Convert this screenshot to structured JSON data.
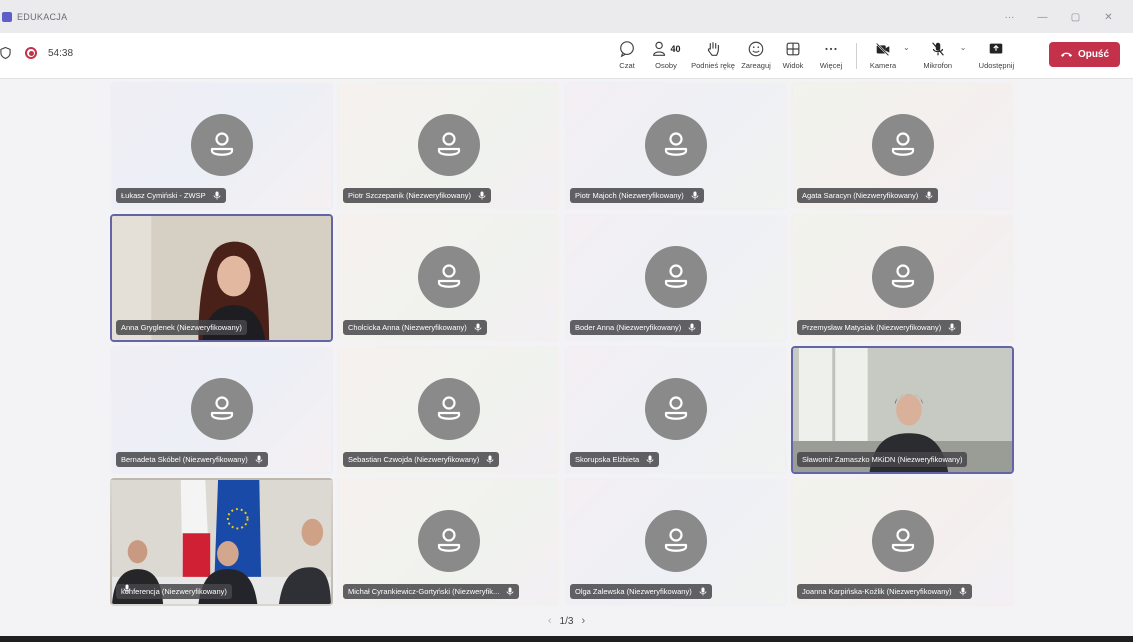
{
  "window": {
    "title": "EDUKACJA",
    "controls": [
      "···",
      "—",
      "▢",
      "✕"
    ]
  },
  "call": {
    "timer": "54:38"
  },
  "toolbar": {
    "chat": "Czat",
    "people": "Osoby",
    "people_count": "40",
    "raise_hand": "Podnieś rękę",
    "react": "Zareaguj",
    "view": "Widok",
    "more": "Więcej",
    "camera": "Kamera",
    "mic": "Mikrofon",
    "share": "Udostępnij",
    "leave": "Opuść"
  },
  "participants": [
    {
      "name": "Łukasz Cymiński - ZWSP"
    },
    {
      "name": "Piotr Szczepanik (Niezweryfikowany)"
    },
    {
      "name": "Piotr Majoch (Niezweryfikowany)"
    },
    {
      "name": "Agata Saracyn (Niezweryfikowany)"
    },
    {
      "name": "Anna Gryglenek (Niezweryfikowany)"
    },
    {
      "name": "Cholcicka Anna (Niezweryfikowany)"
    },
    {
      "name": "Boder Anna (Niezweryfikowany)"
    },
    {
      "name": "Przemysław Matysiak (Niezweryfikowany)"
    },
    {
      "name": "Bernadeta Skóbel (Niezweryfikowany)"
    },
    {
      "name": "Sebastian Czwojda (Niezweryfikowany)"
    },
    {
      "name": "Skorupska Elżbieta"
    },
    {
      "name": "Sławomir Zamaszko MKiDN (Niezweryfikowany)"
    },
    {
      "name": "konferencja (Niezweryfikowany)"
    },
    {
      "name": "Michał Cyrankiewicz-Gortyński (Niezweryfik..."
    },
    {
      "name": "Olga Zalewska (Niezweryfikowany)"
    },
    {
      "name": "Joanna Karpińska-Koźlik (Niezweryfikowany)"
    }
  ],
  "pager": {
    "label": "1/3",
    "prev": "‹",
    "next": "›"
  },
  "colors": {
    "accent": "#6264a7",
    "leave": "#c4314b",
    "avatar": "#8a8a8a"
  }
}
